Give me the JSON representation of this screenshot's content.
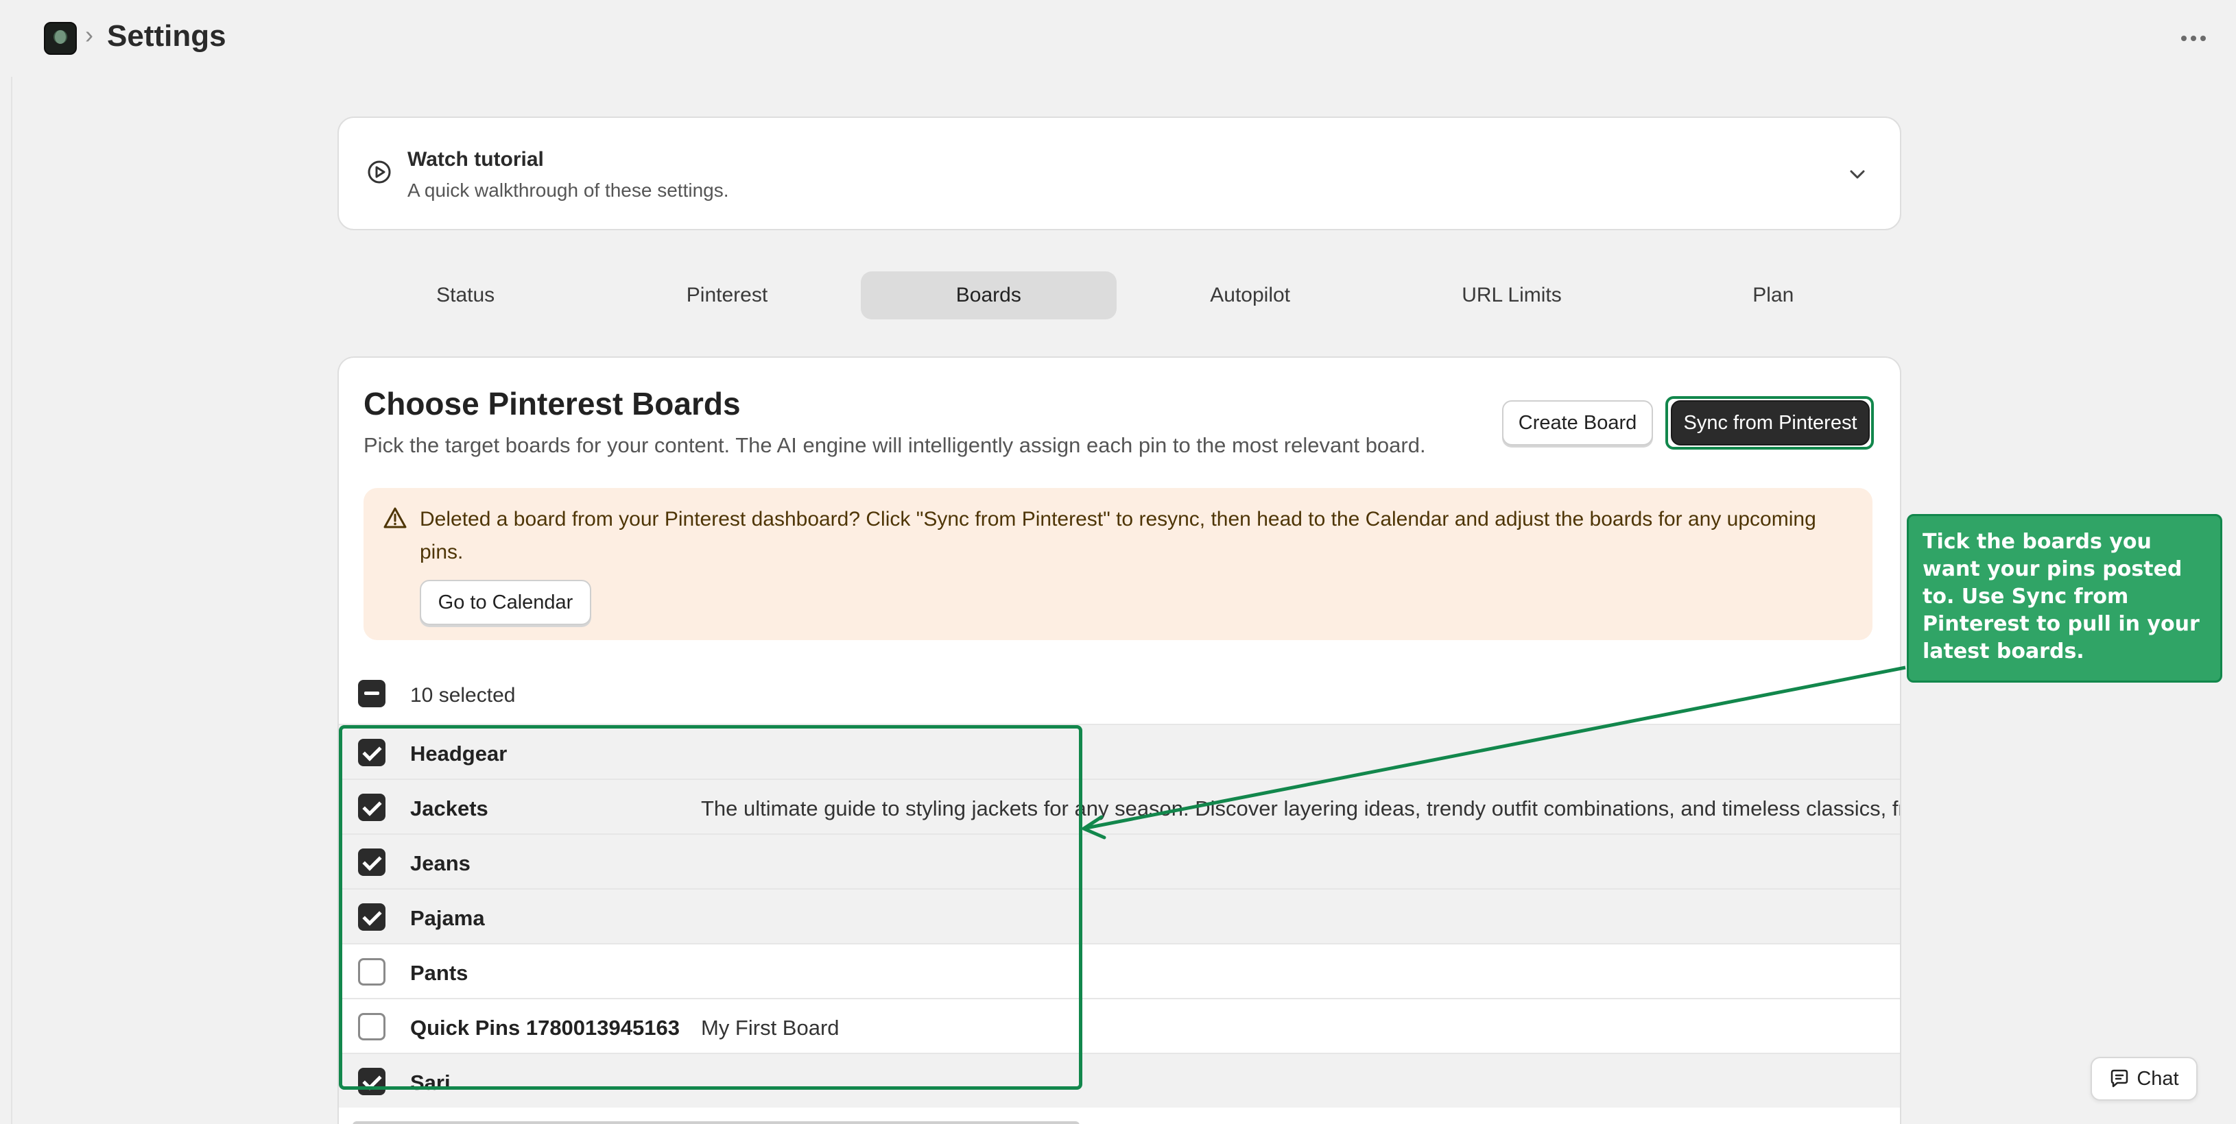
{
  "header": {
    "title": "Settings",
    "separator": "›",
    "logo_icon": "app-logo-icon",
    "more_icon": "more-horizontal-icon"
  },
  "tutorial": {
    "title": "Watch tutorial",
    "subtitle": "A quick walkthrough of these settings.",
    "icon": "play-circle-icon",
    "toggle_icon": "chevron-down-icon"
  },
  "tabs": [
    {
      "label": "Status",
      "active": false
    },
    {
      "label": "Pinterest",
      "active": false
    },
    {
      "label": "Boards",
      "active": true
    },
    {
      "label": "Autopilot",
      "active": false
    },
    {
      "label": "URL Limits",
      "active": false
    },
    {
      "label": "Plan",
      "active": false
    }
  ],
  "boards": {
    "title": "Choose Pinterest Boards",
    "subtitle": "Pick the target boards for your content. The AI engine will intelligently assign each pin to the most relevant board.",
    "create_label": "Create Board",
    "sync_label": "Sync from Pinterest",
    "banner": {
      "text": "Deleted a board from your Pinterest dashboard? Click \"Sync from Pinterest\" to resync, then head to the Calendar and adjust the boards for any upcoming pins.",
      "button_label": "Go to Calendar",
      "icon": "warning-triangle-icon"
    },
    "selected_count": "10 selected",
    "rows": [
      {
        "name": "Headgear",
        "description": "",
        "checked": true
      },
      {
        "name": "Jackets",
        "description": "The ultimate guide to styling jackets for any season. Discover layering ideas, trendy outfit combinations, and timeless classics, fro",
        "checked": true
      },
      {
        "name": "Jeans",
        "description": "",
        "checked": true
      },
      {
        "name": "Pajama",
        "description": "",
        "checked": true
      },
      {
        "name": "Pants",
        "description": "",
        "checked": false
      },
      {
        "name": "Quick Pins 1780013945163",
        "description": "My First Board",
        "checked": false
      },
      {
        "name": "Sari",
        "description": "",
        "checked": true
      }
    ]
  },
  "callout": {
    "text": "Tick the boards you want your pins posted to. Use Sync from Pinterest to pull in your latest boards."
  },
  "chat": {
    "label": "Chat",
    "icon": "chat-bubble-icon"
  },
  "colors": {
    "highlight": "#12874c",
    "callout_bg": "#30a466",
    "banner_bg": "#fdeee2",
    "primary_btn": "#2b2b2b"
  }
}
